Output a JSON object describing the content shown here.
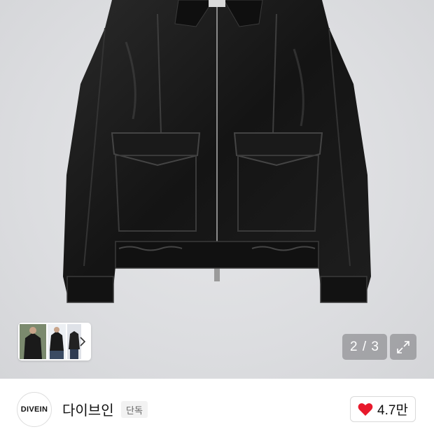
{
  "gallery": {
    "counter": "2 / 3",
    "thumbnail_count": 3
  },
  "icons": {
    "thumb_next": "chevron-right-icon",
    "expand": "expand-arrows-icon",
    "like": "heart-icon"
  },
  "brand": {
    "logo_text": "DIVEIN",
    "name": "다이브인",
    "badge": "단독"
  },
  "like": {
    "count": "4.7만"
  },
  "colors": {
    "heart": "#e8192c",
    "overlay": "#78787c"
  }
}
